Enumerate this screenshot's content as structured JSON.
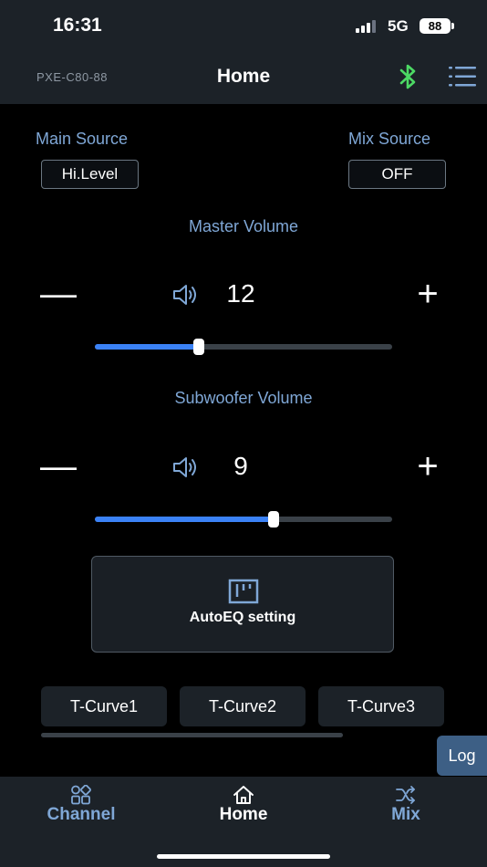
{
  "status_bar": {
    "time": "16:31",
    "network": "5G",
    "battery": "88"
  },
  "header": {
    "device": "PXE-C80-88",
    "title": "Home",
    "bluetooth_icon": "bluetooth-icon",
    "menu_icon": "list-menu-icon"
  },
  "sources": {
    "main": {
      "label": "Main Source",
      "value": "Hi.Level"
    },
    "mix": {
      "label": "Mix Source",
      "value": "OFF"
    }
  },
  "master_volume": {
    "title": "Master Volume",
    "minus": "—",
    "plus": "+",
    "value": "12",
    "slider_fraction": 0.35
  },
  "subwoofer_volume": {
    "title": "Subwoofer Volume",
    "minus": "—",
    "plus": "+",
    "value": "9",
    "slider_fraction": 0.6
  },
  "autoeq": {
    "label": "AutoEQ setting"
  },
  "curves": [
    "T-Curve1",
    "T-Curve2",
    "T-Curve3"
  ],
  "log": {
    "label": "Log"
  },
  "tabs": [
    {
      "label": "Channel",
      "icon": "grid-icon",
      "active": false
    },
    {
      "label": "Home",
      "icon": "home-icon",
      "active": true
    },
    {
      "label": "Mix",
      "icon": "shuffle-icon",
      "active": false
    }
  ],
  "colors": {
    "accent": "#3b82f6",
    "label_blue": "#7fa7d6",
    "bluetooth": "#4cd964",
    "inactive_tab": "#7fa7d6",
    "log_bg": "#3d5f85"
  }
}
